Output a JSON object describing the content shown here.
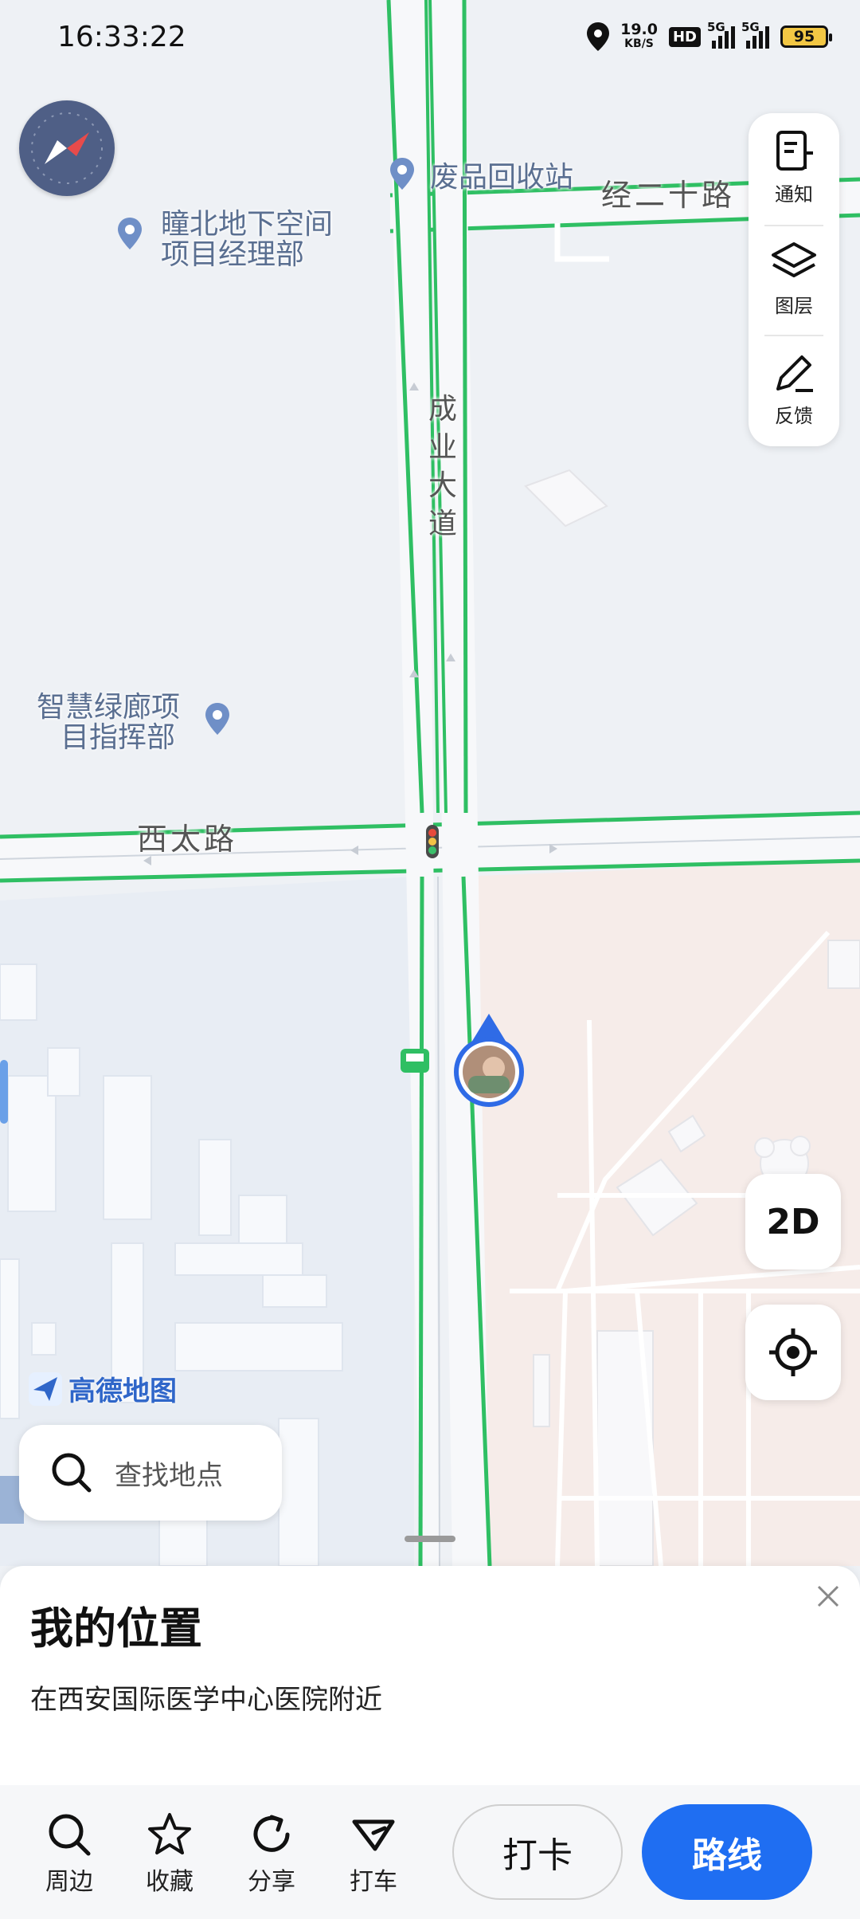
{
  "status_bar": {
    "time": "16:33:22",
    "net_speed_value": "19.0",
    "net_speed_unit": "KB/S",
    "hd_badge": "HD",
    "signal1_tag": "5G",
    "signal2_tag": "5G",
    "battery": "95"
  },
  "map": {
    "pois": [
      {
        "name": "废品回收站"
      },
      {
        "name_line1": "瞳北地下空间",
        "name_line2": "项目经理部"
      },
      {
        "name_line1": "智慧绿廊项",
        "name_line2": "目指挥部"
      }
    ],
    "roads": {
      "road_a": "经二十路",
      "road_b": "西太路",
      "road_c_chars": [
        "成",
        "业",
        "大",
        "道"
      ]
    },
    "logo_text": "高德地图"
  },
  "right_panel": {
    "notify": "通知",
    "layers": "图层",
    "feedback": "反馈"
  },
  "view_mode": "2D",
  "search": {
    "placeholder": "查找地点"
  },
  "sheet": {
    "title": "我的位置",
    "subtitle": "在西安国际医学中心医院附近"
  },
  "toolbar": {
    "nearby": "周边",
    "favorites": "收藏",
    "share": "分享",
    "taxi": "打车",
    "checkin": "打卡",
    "route": "路线"
  }
}
